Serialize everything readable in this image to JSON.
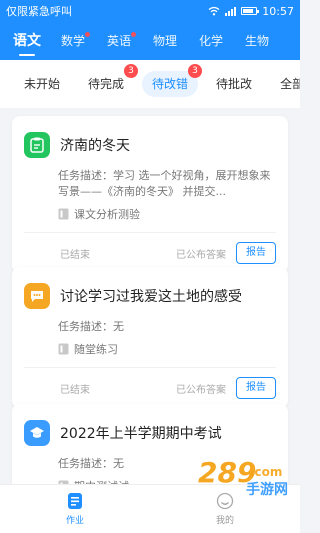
{
  "status_bar": {
    "carrier": "仅限紧急呼叫",
    "time": "10:57"
  },
  "subjects": [
    {
      "label": "语文",
      "active": true,
      "dot": false
    },
    {
      "label": "数学",
      "active": false,
      "dot": true
    },
    {
      "label": "英语",
      "active": false,
      "dot": true
    },
    {
      "label": "物理",
      "active": false,
      "dot": false
    },
    {
      "label": "化学",
      "active": false,
      "dot": false
    },
    {
      "label": "生物",
      "active": false,
      "dot": false
    }
  ],
  "filters": [
    {
      "label": "未开始",
      "badge": ""
    },
    {
      "label": "待完成",
      "badge": "3"
    },
    {
      "label": "待改错",
      "badge": "3",
      "active": true
    },
    {
      "label": "待批改",
      "badge": ""
    },
    {
      "label": "全部课",
      "badge": ""
    }
  ],
  "cards": [
    {
      "title": "济南的冬天",
      "description": "任务描述：学习 选一个好视角，展开想象来写景——《济南的冬天》 并提交...",
      "type": "课文分析测验",
      "status": "已结束",
      "publish": "已公布答案",
      "button": "报告",
      "icon_color": "#22c55e",
      "icon": "clipboard-icon"
    },
    {
      "title": "讨论学习过我爱这土地的感受",
      "description": "任务描述：无",
      "type": "随堂练习",
      "status": "已结束",
      "publish": "已公布答案",
      "button": "报告",
      "icon_color": "#f5a623",
      "icon": "chat-icon"
    },
    {
      "title": "2022年上半学期期中考试",
      "description": "任务描述：无",
      "type": "期中测试试",
      "icon_color": "#3b9cff",
      "icon": "graduation-cap-icon"
    }
  ],
  "bottom_nav": [
    {
      "label": "作业",
      "active": true,
      "icon": "homework-icon"
    },
    {
      "label": "我的",
      "active": false,
      "icon": "profile-icon"
    }
  ],
  "watermark": {
    "text": "289",
    "suffix": ".com",
    "subtitle": "手游网"
  },
  "colors": {
    "primary": "#1f8fff",
    "badge": "#ff4d4f",
    "background": "#f2f4f7"
  }
}
